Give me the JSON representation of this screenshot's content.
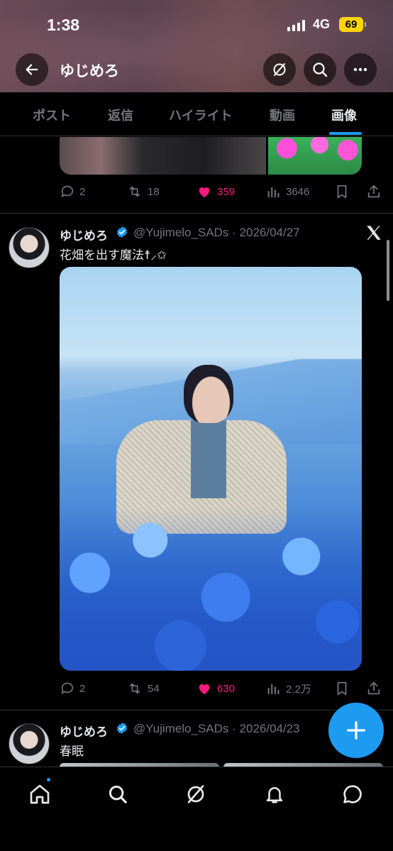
{
  "status_bar": {
    "time": "1:38",
    "network": "4G",
    "battery": "69"
  },
  "header": {
    "title": "ゆじめろ",
    "icons": [
      "back-arrow-icon",
      "grok-icon",
      "search-icon",
      "more-icon"
    ]
  },
  "tabs": [
    {
      "label": "ポスト",
      "active": false
    },
    {
      "label": "返信",
      "active": false
    },
    {
      "label": "ハイライト",
      "active": false
    },
    {
      "label": "動画",
      "active": false
    },
    {
      "label": "画像",
      "active": true
    }
  ],
  "previous_post": {
    "replies": "2",
    "reposts": "18",
    "likes": "359",
    "views": "3646"
  },
  "post": {
    "name": "ゆじめろ",
    "handle": "@Yujimelo_SADs · 2026/04/27",
    "text": "花畑を出す魔法☨⸝✩",
    "replies": "2",
    "reposts": "54",
    "likes": "630",
    "views": "2.2万"
  },
  "next_post": {
    "name": "ゆじめろ",
    "handle": "@Yujimelo_SADs · 2026/04/23",
    "text": "春眠"
  },
  "colors": {
    "accent": "#1d9bf0",
    "like": "#f91880",
    "muted": "#71767b",
    "background": "#000000"
  },
  "bottom_nav": [
    "home-icon",
    "explore-icon",
    "grok-icon",
    "notifications-icon",
    "messages-icon"
  ]
}
